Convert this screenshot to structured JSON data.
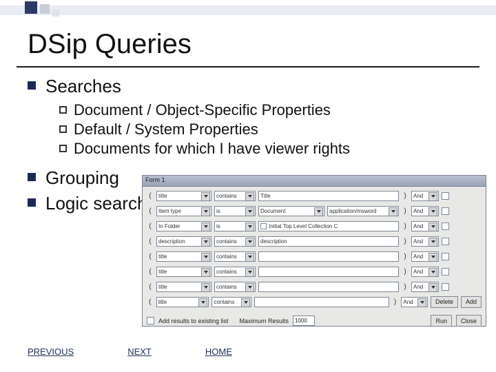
{
  "title": "DSip Queries",
  "bullets": {
    "searches": "Searches",
    "sub": [
      "Document / Object-Specific Properties",
      "Default / System Properties",
      "Documents for which I have viewer rights"
    ],
    "grouping": "Grouping",
    "logic": "Logic search"
  },
  "dialog": {
    "title": "Form 1",
    "rows": [
      {
        "field": "title",
        "op": "contains",
        "value": "Title",
        "and": "And"
      },
      {
        "field": "Item type",
        "op": "is",
        "value": "Document",
        "extra": "application/msword",
        "and": "And"
      },
      {
        "field": "In Folder",
        "op": "is",
        "value": "Initial Top Level Collection C",
        "and": "And"
      },
      {
        "field": "description",
        "op": "contains",
        "value": "description",
        "and": "And"
      },
      {
        "field": "title",
        "op": "contains",
        "value": "",
        "and": "And"
      },
      {
        "field": "title",
        "op": "contains",
        "value": "",
        "and": "And"
      },
      {
        "field": "title",
        "op": "contains",
        "value": "",
        "and": "And"
      },
      {
        "field": "title",
        "op": "contains",
        "value": "",
        "and": "And"
      }
    ],
    "buttons": {
      "delete": "Delete",
      "add": "Add",
      "run": "Run",
      "close": "Close"
    },
    "bottom": {
      "chk_label": "Add results to existing list",
      "max_label": "Maximum Results",
      "max_value": "1000"
    }
  },
  "footer": {
    "prev": "PREVIOUS",
    "next": "NEXT",
    "home": "HOME"
  }
}
